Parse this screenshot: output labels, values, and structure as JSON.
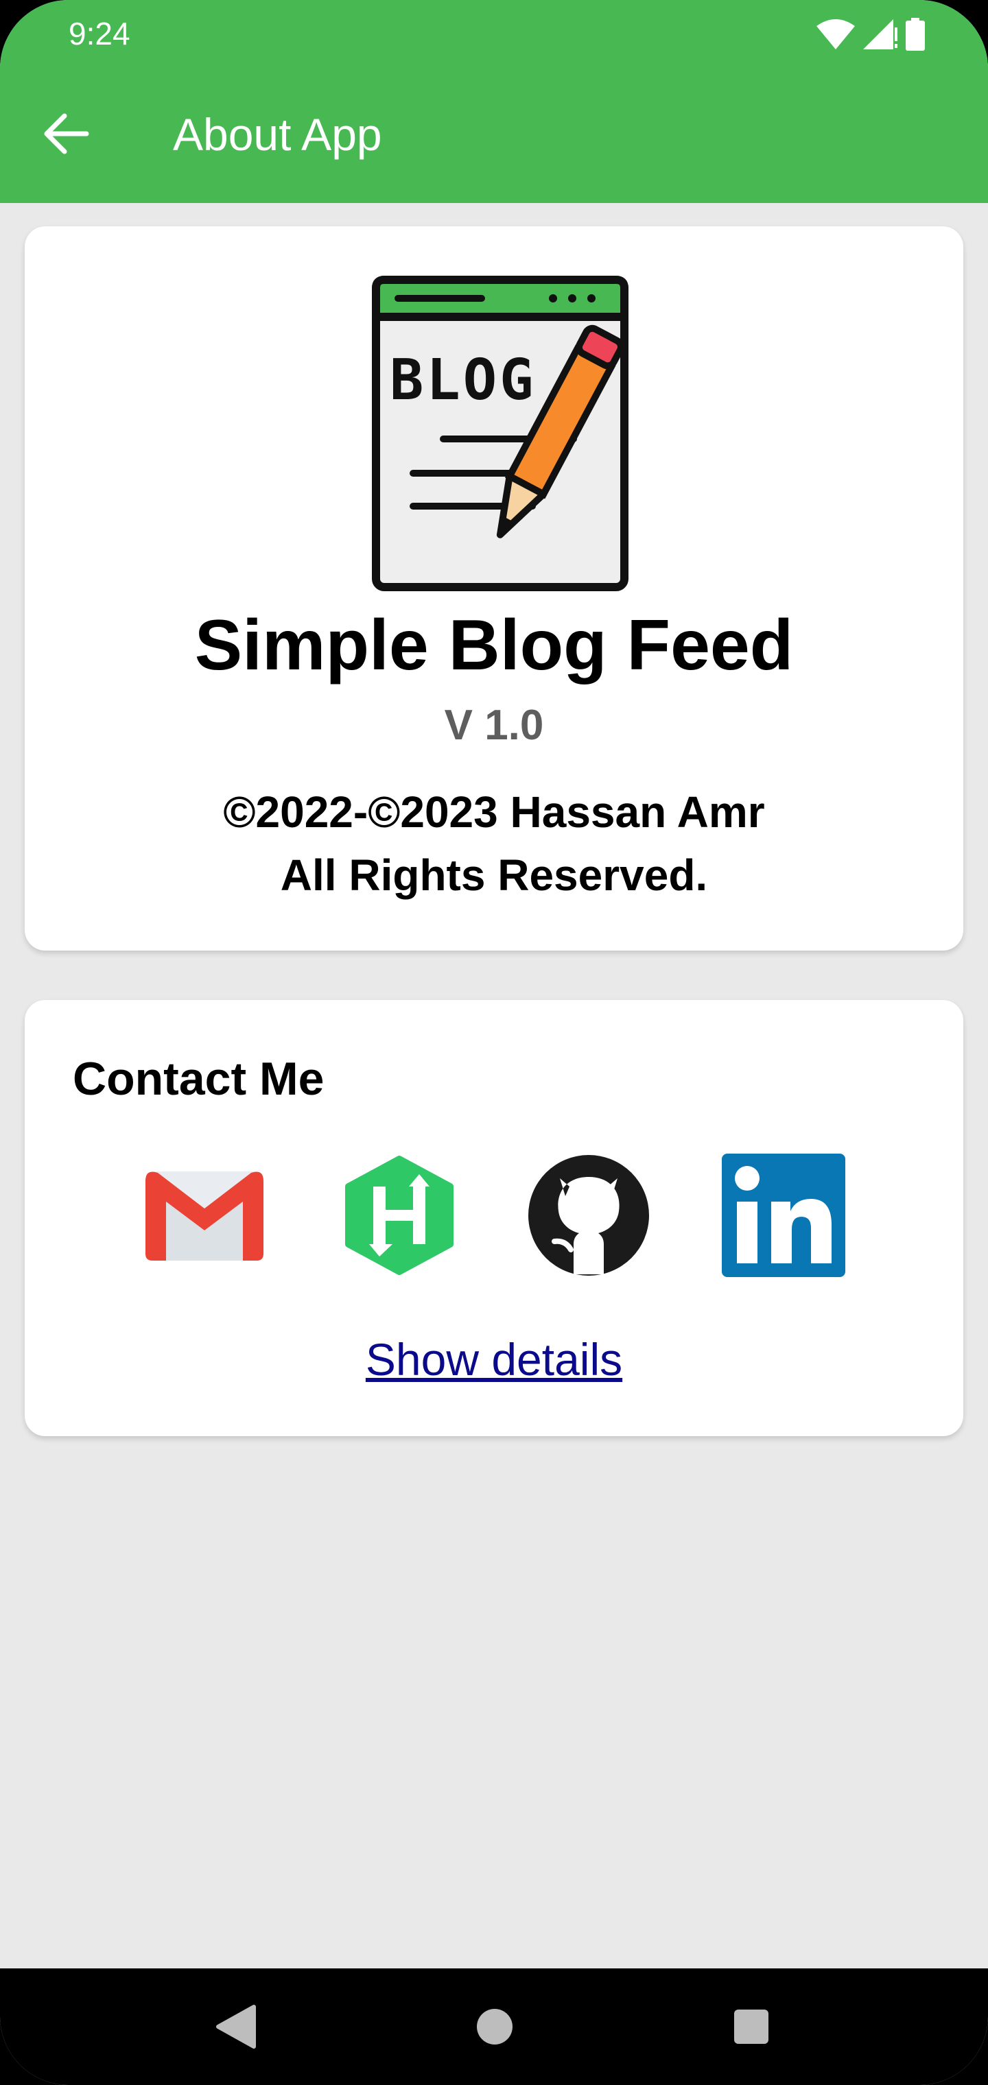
{
  "status_bar": {
    "time": "9:24"
  },
  "app_bar": {
    "title": "About App"
  },
  "about": {
    "app_name": "Simple Blog Feed",
    "version": "V 1.0",
    "copyright_line1": "©2022-©2023 Hassan Amr",
    "copyright_line2": "All Rights Reserved.",
    "logo_text": "BLOG"
  },
  "contact": {
    "title": "Contact Me",
    "icons": [
      "gmail-icon",
      "hackerrank-icon",
      "github-icon",
      "linkedin-icon"
    ],
    "show_details": "Show details"
  },
  "colors": {
    "primary": "#48b853",
    "background": "#e9e9e9",
    "link": "#0a0a8a",
    "version_text": "#5e5e5e"
  }
}
